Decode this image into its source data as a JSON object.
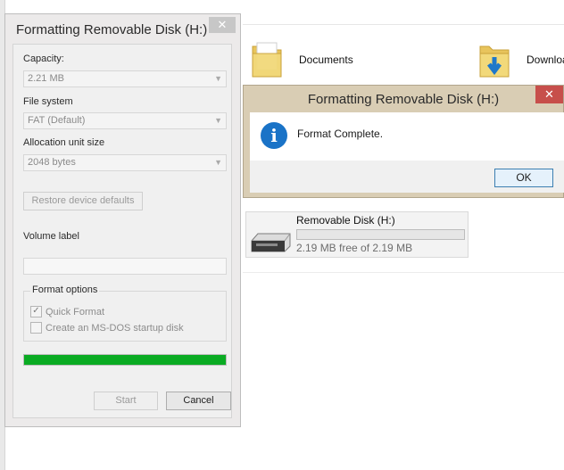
{
  "explorer": {
    "folders": [
      {
        "label": "Documents",
        "icon": "folder-icon"
      },
      {
        "label": "Downloa",
        "icon": "downloads-folder-icon"
      }
    ],
    "drive": {
      "name": "Removable Disk (H:)",
      "free_text": "2.19 MB free of 2.19 MB",
      "used_fraction": 0
    }
  },
  "format_dialog": {
    "title": "Formatting Removable Disk (H:)",
    "close_glyph": "✕",
    "capacity_label": "Capacity:",
    "capacity_value": "2.21 MB",
    "filesystem_label": "File system",
    "filesystem_value": "FAT (Default)",
    "allocation_label": "Allocation unit size",
    "allocation_value": "2048 bytes",
    "restore_label": "Restore device defaults",
    "volume_label": "Volume label",
    "volume_value": "",
    "format_options_label": "Format options",
    "quick_format_label": "Quick Format",
    "quick_format_checked": true,
    "msdos_label": "Create an MS-DOS startup disk",
    "msdos_checked": false,
    "progress_percent": 100,
    "progress_color": "#0aab23",
    "start_label": "Start",
    "cancel_label": "Cancel"
  },
  "message_box": {
    "title": "Formatting Removable Disk (H:)",
    "close_glyph": "✕",
    "message": "Format Complete.",
    "icon": "info-icon",
    "ok_label": "OK",
    "close_color": "#c74f4b"
  }
}
